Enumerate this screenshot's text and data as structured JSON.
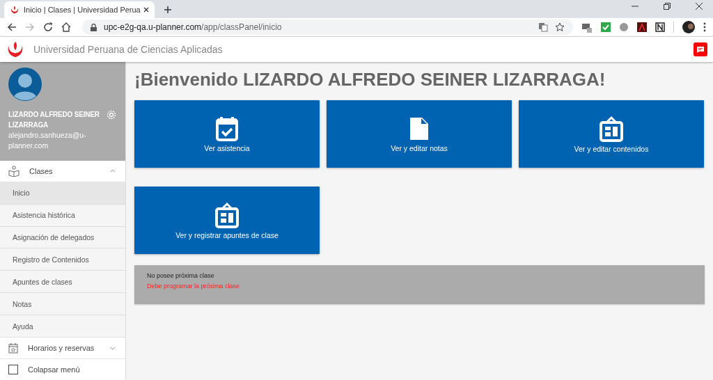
{
  "browser": {
    "tab_title": "Inicio | Clases | Universidad Perua",
    "url_host": "upc-e2g-qa.u-planner.com",
    "url_path": "/app/classPanel/inicio"
  },
  "header": {
    "title": "Universidad Peruana de Ciencias Aplicadas"
  },
  "profile": {
    "name": "LIZARDO ALFREDO SEINER LIZARRAGA",
    "email": "alejandro.sanhueza@u-planner.com"
  },
  "menu": [
    {
      "label": "Clases",
      "kind": "classes",
      "expanded": true,
      "children": [
        {
          "label": "Inicio",
          "selected": true
        },
        {
          "label": "Asistencia histórica",
          "selected": false
        },
        {
          "label": "Asignación de delegados",
          "selected": false
        },
        {
          "label": "Registro de Contenidos",
          "selected": false
        },
        {
          "label": "Apuntes de clases",
          "selected": false
        },
        {
          "label": "Notas",
          "selected": false
        },
        {
          "label": "Ayuda",
          "selected": false
        }
      ]
    },
    {
      "label": "Horarios y reservas",
      "kind": "calendar",
      "expanded": false
    }
  ],
  "collapse": {
    "label": "Colapsar menú",
    "checked": false
  },
  "welcome": "¡Bienvenido LIZARDO ALFREDO SEINER LIZARRAGA!",
  "tiles": [
    {
      "label": "Ver asistencia",
      "kind": "calendar-check"
    },
    {
      "label": "Ver y editar notas",
      "kind": "document"
    },
    {
      "label": "Ver y editar contenidos",
      "kind": "board"
    },
    {
      "label": "Ver y registrar apuntes de clase",
      "kind": "board"
    }
  ],
  "next_class": {
    "message": "No posee próxima clase",
    "warning": "Debe programar la próxima clase"
  }
}
